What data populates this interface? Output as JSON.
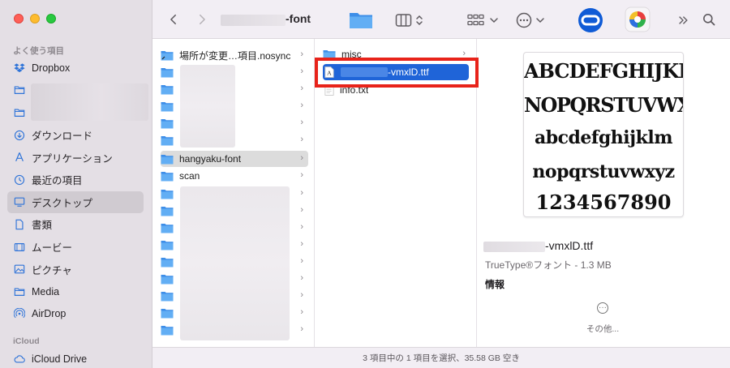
{
  "window": {
    "title": "-font"
  },
  "sidebar": {
    "sections": [
      {
        "title": "よく使う項目",
        "items": [
          {
            "label": "Dropbox",
            "icon": "dropbox-icon"
          },
          {
            "label": "",
            "icon": "folder-icon"
          },
          {
            "label": "",
            "icon": "folder-icon"
          },
          {
            "label": "ダウンロード",
            "icon": "download-icon"
          },
          {
            "label": "アプリケーション",
            "icon": "applications-icon"
          },
          {
            "label": "最近の項目",
            "icon": "clock-icon"
          },
          {
            "label": "デスクトップ",
            "icon": "desktop-icon",
            "selected": true
          },
          {
            "label": "書類",
            "icon": "document-icon"
          },
          {
            "label": "ムービー",
            "icon": "film-icon"
          },
          {
            "label": "ピクチャ",
            "icon": "photo-icon"
          },
          {
            "label": "Media",
            "icon": "folder-icon"
          },
          {
            "label": "AirDrop",
            "icon": "airdrop-icon"
          }
        ]
      },
      {
        "title": "iCloud",
        "items": [
          {
            "label": "iCloud Drive",
            "icon": "icloud-icon"
          }
        ]
      }
    ]
  },
  "column1": {
    "items": [
      {
        "label": "場所が変更…項目.nosync"
      },
      {
        "label": ""
      },
      {
        "label": ""
      },
      {
        "label": ""
      },
      {
        "label": ""
      },
      {
        "label": ""
      },
      {
        "label": "hangyaku-font",
        "highlighted": true
      },
      {
        "label": "scan"
      },
      {
        "label": ""
      },
      {
        "label": ""
      },
      {
        "label": ""
      },
      {
        "label": ""
      },
      {
        "label": ""
      },
      {
        "label": ""
      },
      {
        "label": ""
      },
      {
        "label": ""
      },
      {
        "label": ""
      }
    ]
  },
  "column2": {
    "items": [
      {
        "label": "misc",
        "type": "folder"
      },
      {
        "label": "-vmxlD.ttf",
        "type": "font-file",
        "selected": true
      },
      {
        "label": "info.txt",
        "type": "text-file"
      }
    ]
  },
  "preview": {
    "lines": [
      "ABCDEFGHIJKLM",
      "NOPQRSTUVWXYZ",
      "abcdefghijklm",
      "nopqrstuvwxyz",
      "1234567890"
    ],
    "file_name": "-vmxlD.ttf",
    "kind": "TrueType®フォント - 1.3 MB",
    "info_label": "情報",
    "more_label": "その他..."
  },
  "statusbar": {
    "text": "3 項目中の 1 項目を選択、35.58 GB 空き"
  },
  "colors": {
    "accent": "#1f64d8",
    "folder": "#5aa6f0",
    "highlight_box": "#e8231a"
  }
}
